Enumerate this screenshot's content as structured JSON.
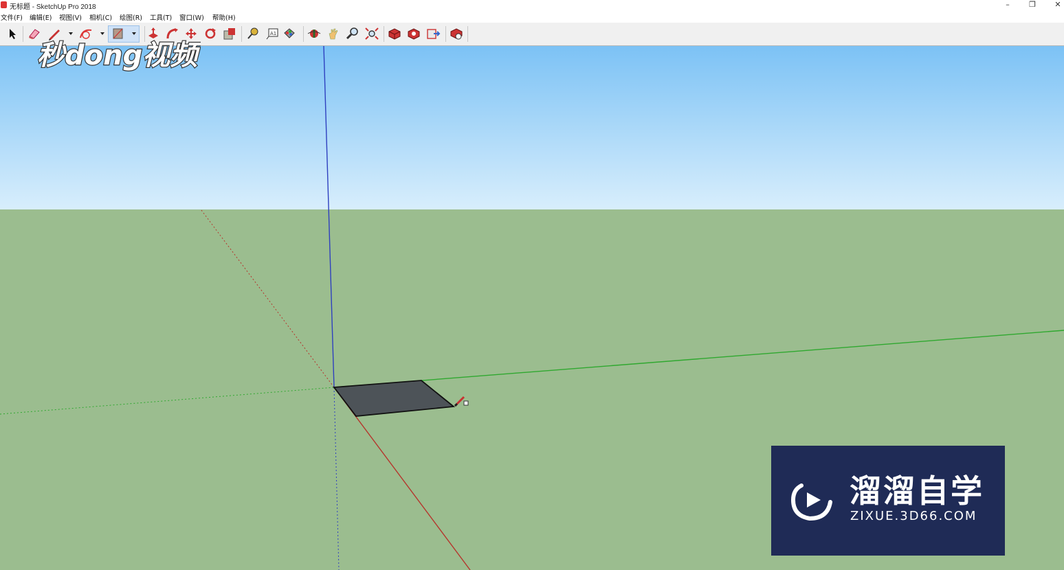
{
  "window": {
    "title": "无标题 - SketchUp Pro 2018",
    "controls": [
      "–",
      "❐",
      "✕"
    ]
  },
  "menu": [
    "文件(F)",
    "编辑(E)",
    "视图(V)",
    "相机(C)",
    "绘图(R)",
    "工具(T)",
    "窗口(W)",
    "帮助(H)"
  ],
  "toolbar": {
    "tools": [
      "select-icon",
      "eraser-icon",
      "line-pencil-icon",
      "arc-icon",
      "rectangle-icon",
      "push-pull-icon",
      "follow-me-icon",
      "move-icon",
      "rotate-icon",
      "scale-icon",
      "tape-measure-icon",
      "text-icon",
      "paint-bucket-icon",
      "orbit-icon",
      "pan-icon",
      "zoom-icon",
      "zoom-extents-icon",
      "3d-warehouse-icon",
      "extension-warehouse-icon",
      "layout-icon",
      "extension-manager-icon"
    ],
    "active_tool": "rectangle-icon"
  },
  "colors": {
    "sky_top": "#7cc2f5",
    "sky_bottom": "#d8eefc",
    "ground": "#9bbd8f",
    "red_axis": "#b5362d",
    "green_axis": "#2fa82f",
    "blue_axis": "#2e3fbf",
    "face": "#4d5358"
  },
  "watermark_logo": "秒dong视频",
  "watermark_box": {
    "title": "溜溜自学",
    "url": "ZIXUE.3D66.COM"
  }
}
